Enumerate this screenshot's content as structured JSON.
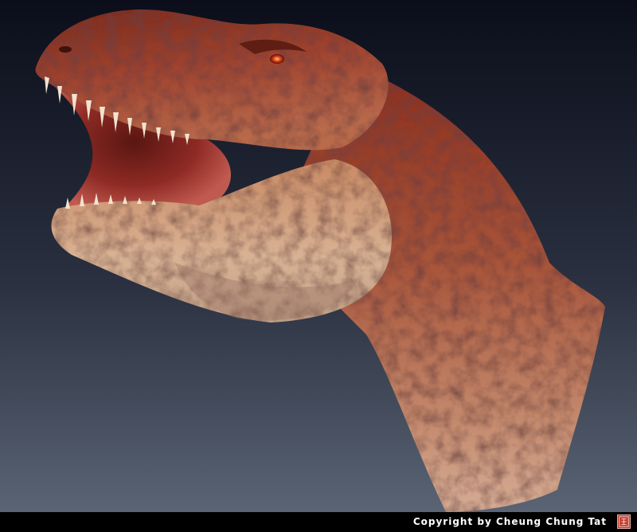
{
  "image": {
    "subject": "Tyrannosaurus rex head and neck render",
    "background_top_color": "#0b0e1a",
    "background_bottom_color": "#525c6c",
    "skin_dark_color": "#6e2418",
    "skin_mid_color": "#b0503a",
    "skin_light_color": "#d8b49a",
    "eye_color": "#e0401a"
  },
  "footer": {
    "copyright": "Copyright by Cheung Chung Tat",
    "background_color": "#000000",
    "text_color": "#ffffff",
    "seal_icon": "red-seal-stamp",
    "seal_color": "#c0392b"
  }
}
